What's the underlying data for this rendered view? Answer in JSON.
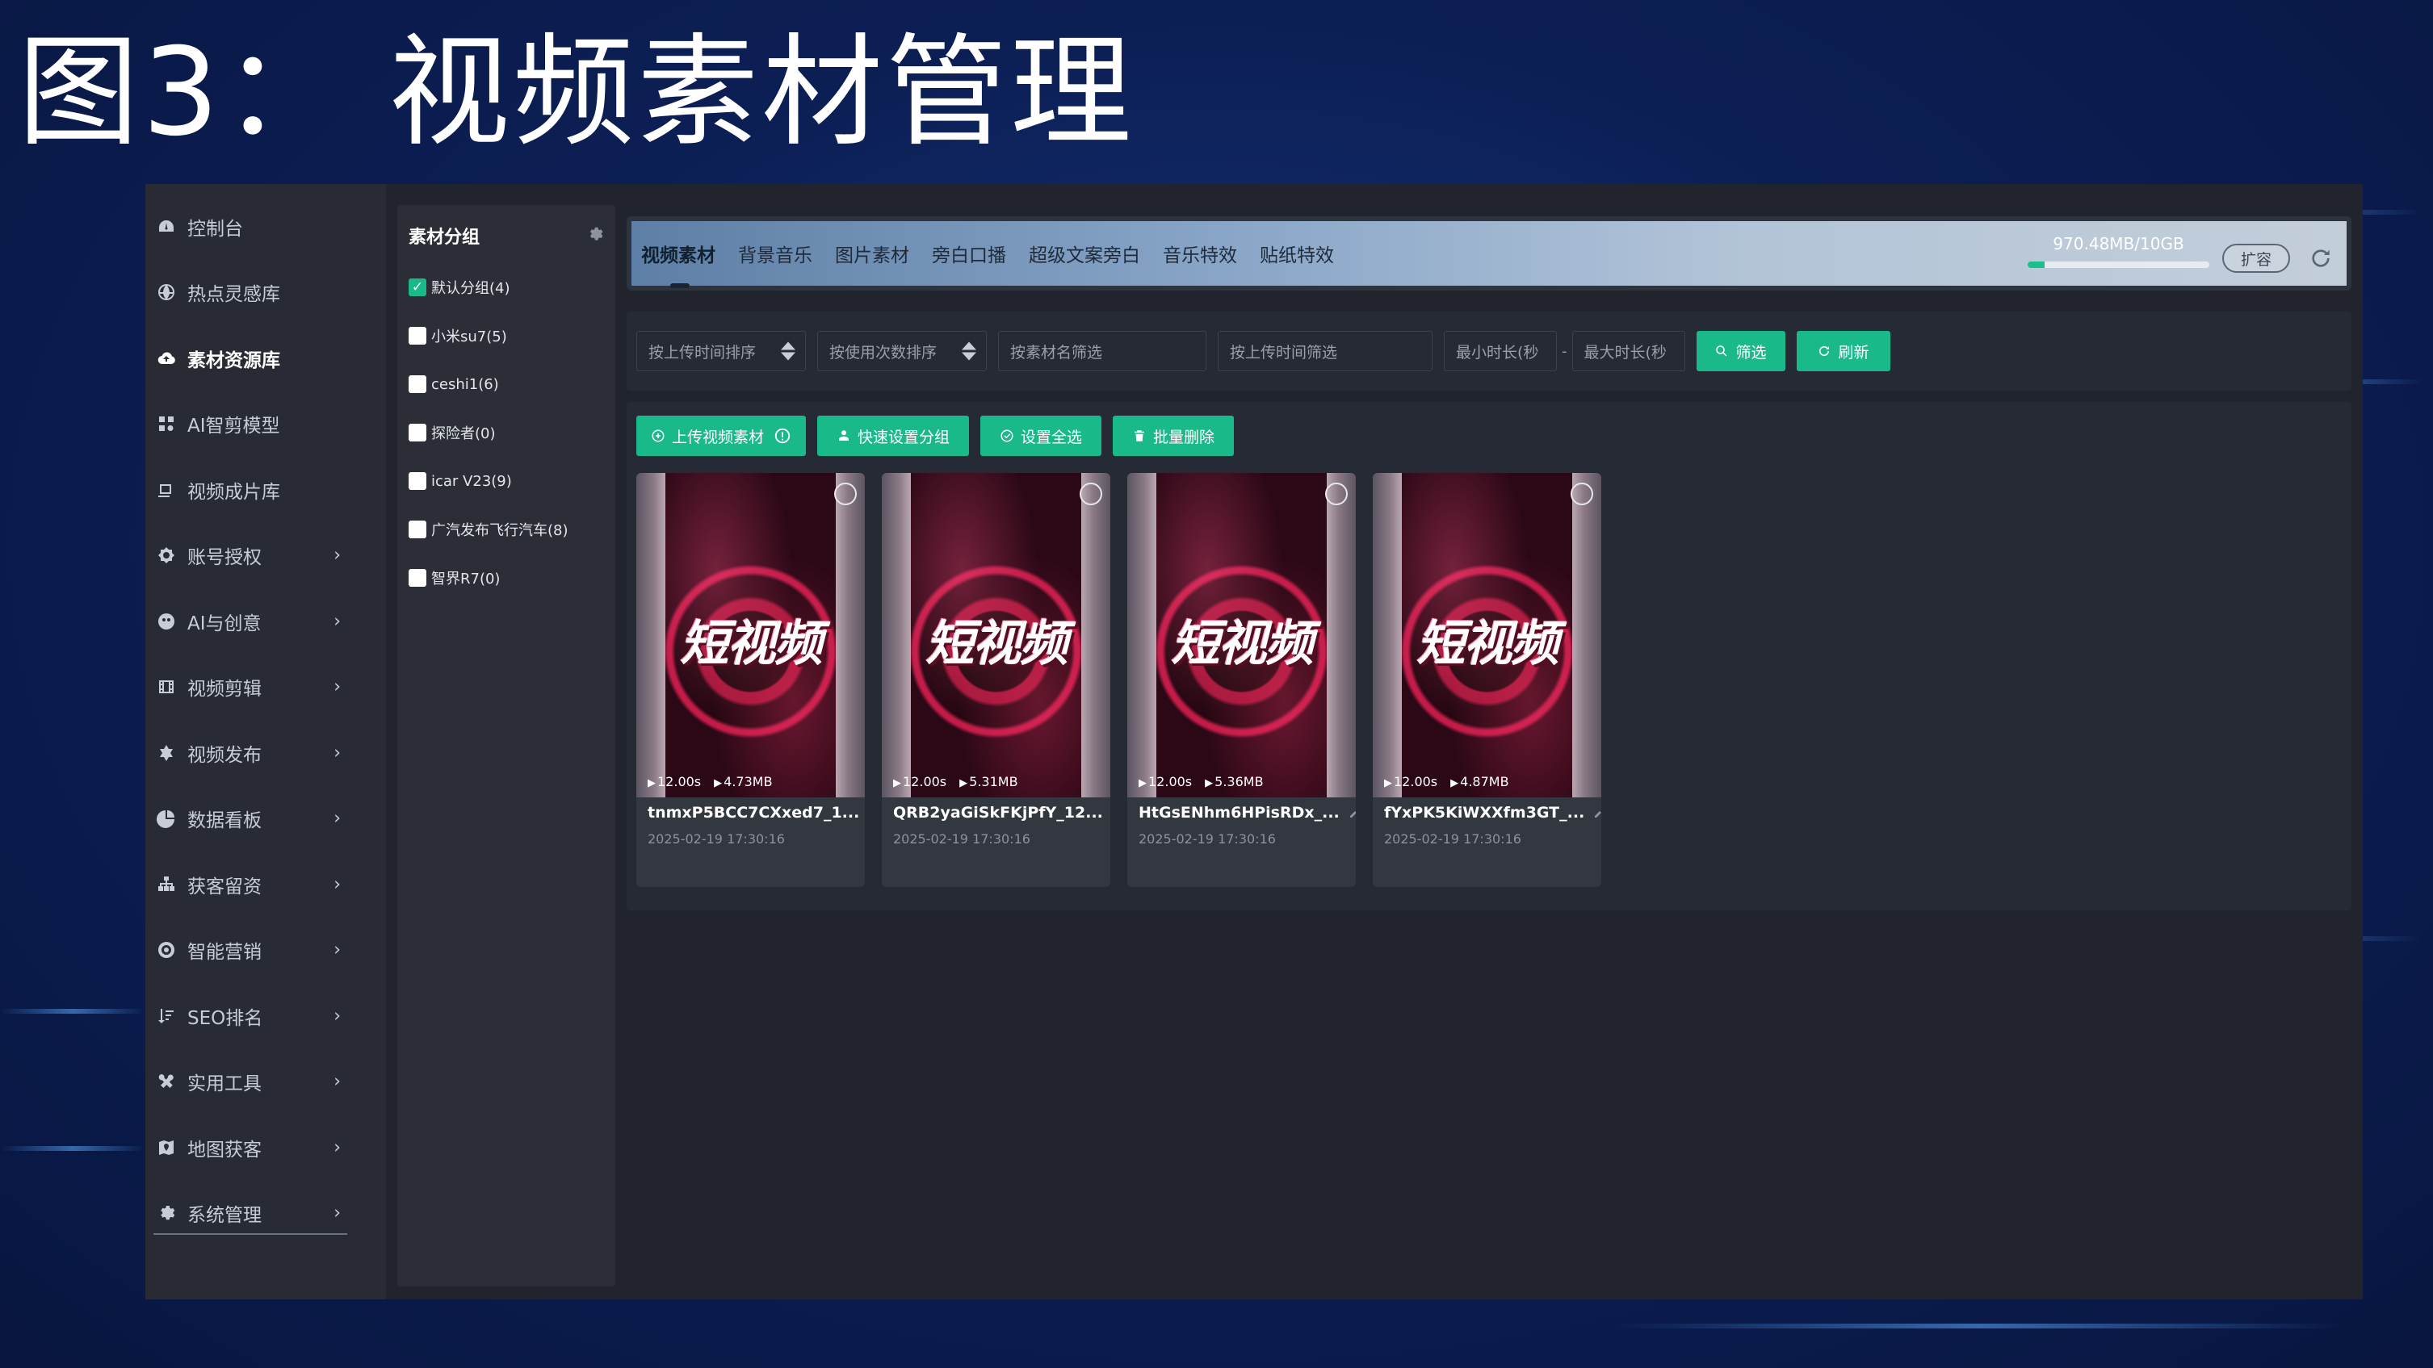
{
  "page": {
    "title": "图3： 视频素材管理"
  },
  "sidebar": {
    "items": [
      {
        "label": "控制台",
        "icon": "dashboard-icon",
        "active": false,
        "has_arrow": false
      },
      {
        "label": "热点灵感库",
        "icon": "globe-icon",
        "active": false,
        "has_arrow": false
      },
      {
        "label": "素材资源库",
        "icon": "cloud-icon",
        "active": true,
        "has_arrow": false
      },
      {
        "label": "AI智剪模型",
        "icon": "model-icon",
        "active": false,
        "has_arrow": false
      },
      {
        "label": "视频成片库",
        "icon": "gallery-icon",
        "active": false,
        "has_arrow": false
      },
      {
        "label": "账号授权",
        "icon": "key-icon",
        "active": false,
        "has_arrow": true
      },
      {
        "label": "AI与创意",
        "icon": "ai-icon",
        "active": false,
        "has_arrow": true
      },
      {
        "label": "视频剪辑",
        "icon": "film-icon",
        "active": false,
        "has_arrow": true
      },
      {
        "label": "视频发布",
        "icon": "publish-icon",
        "active": false,
        "has_arrow": true
      },
      {
        "label": "数据看板",
        "icon": "pie-chart-icon",
        "active": false,
        "has_arrow": true
      },
      {
        "label": "获客留资",
        "icon": "org-chart-icon",
        "active": false,
        "has_arrow": true
      },
      {
        "label": "智能营销",
        "icon": "target-icon",
        "active": false,
        "has_arrow": true
      },
      {
        "label": "SEO排名",
        "icon": "sort-icon",
        "active": false,
        "has_arrow": true
      },
      {
        "label": "实用工具",
        "icon": "tools-icon",
        "active": false,
        "has_arrow": true
      },
      {
        "label": "地图获客",
        "icon": "map-icon",
        "active": false,
        "has_arrow": true
      },
      {
        "label": "系统管理",
        "icon": "settings-icon",
        "active": false,
        "has_arrow": true
      }
    ],
    "arrow": "›"
  },
  "groups": {
    "title": "素材分组",
    "items": [
      {
        "label": "默认分组(4)",
        "checked": true
      },
      {
        "label": "小米su7(5)",
        "checked": false
      },
      {
        "label": "ceshi1(6)",
        "checked": false
      },
      {
        "label": "探险者(0)",
        "checked": false
      },
      {
        "label": "icar V23(9)",
        "checked": false
      },
      {
        "label": "广汽发布飞行汽车(8)",
        "checked": false
      },
      {
        "label": "智界R7(0)",
        "checked": false
      }
    ]
  },
  "tabs": [
    {
      "label": "视频素材",
      "active": true
    },
    {
      "label": "背景音乐",
      "active": false
    },
    {
      "label": "图片素材",
      "active": false
    },
    {
      "label": "旁白口播",
      "active": false
    },
    {
      "label": "超级文案旁白",
      "active": false
    },
    {
      "label": "音乐特效",
      "active": false
    },
    {
      "label": "贴纸特效",
      "active": false
    }
  ],
  "storage": {
    "text": "970.48MB/10GB",
    "used_fraction": 0.095,
    "expand_label": "扩容"
  },
  "filters": {
    "sort_upload": "按上传时间排序",
    "sort_usage": "按使用次数排序",
    "name_placeholder": "按素材名筛选",
    "time_placeholder": "按上传时间筛选",
    "min_duration": "最小时长(秒",
    "dash": "-",
    "max_duration": "最大时长(秒",
    "filter_btn": "筛选",
    "refresh_btn": "刷新"
  },
  "actions": {
    "upload": "上传视频素材",
    "quick_group": "快速设置分组",
    "select_all": "设置全选",
    "batch_delete": "批量删除"
  },
  "cards": [
    {
      "overlay": "短视频",
      "duration": "12.00s",
      "size": "4.73MB",
      "name": "tnmxP5BCC7CXxed7_1...",
      "date": "2025-02-19 17:30:16"
    },
    {
      "overlay": "短视频",
      "duration": "12.00s",
      "size": "5.31MB",
      "name": "QRB2yaGiSkFKjPfY_12...",
      "date": "2025-02-19 17:30:16"
    },
    {
      "overlay": "短视频",
      "duration": "12.00s",
      "size": "5.36MB",
      "name": "HtGsENhm6HPisRDx_...",
      "date": "2025-02-19 17:30:16"
    },
    {
      "overlay": "短视频",
      "duration": "12.00s",
      "size": "4.87MB",
      "name": "fYxPK5KiWXXfm3GT_...",
      "date": "2025-02-19 17:30:16"
    }
  ],
  "colors": {
    "accent": "#19b98a",
    "panel": "#21242d",
    "sidebar": "#282b34"
  }
}
